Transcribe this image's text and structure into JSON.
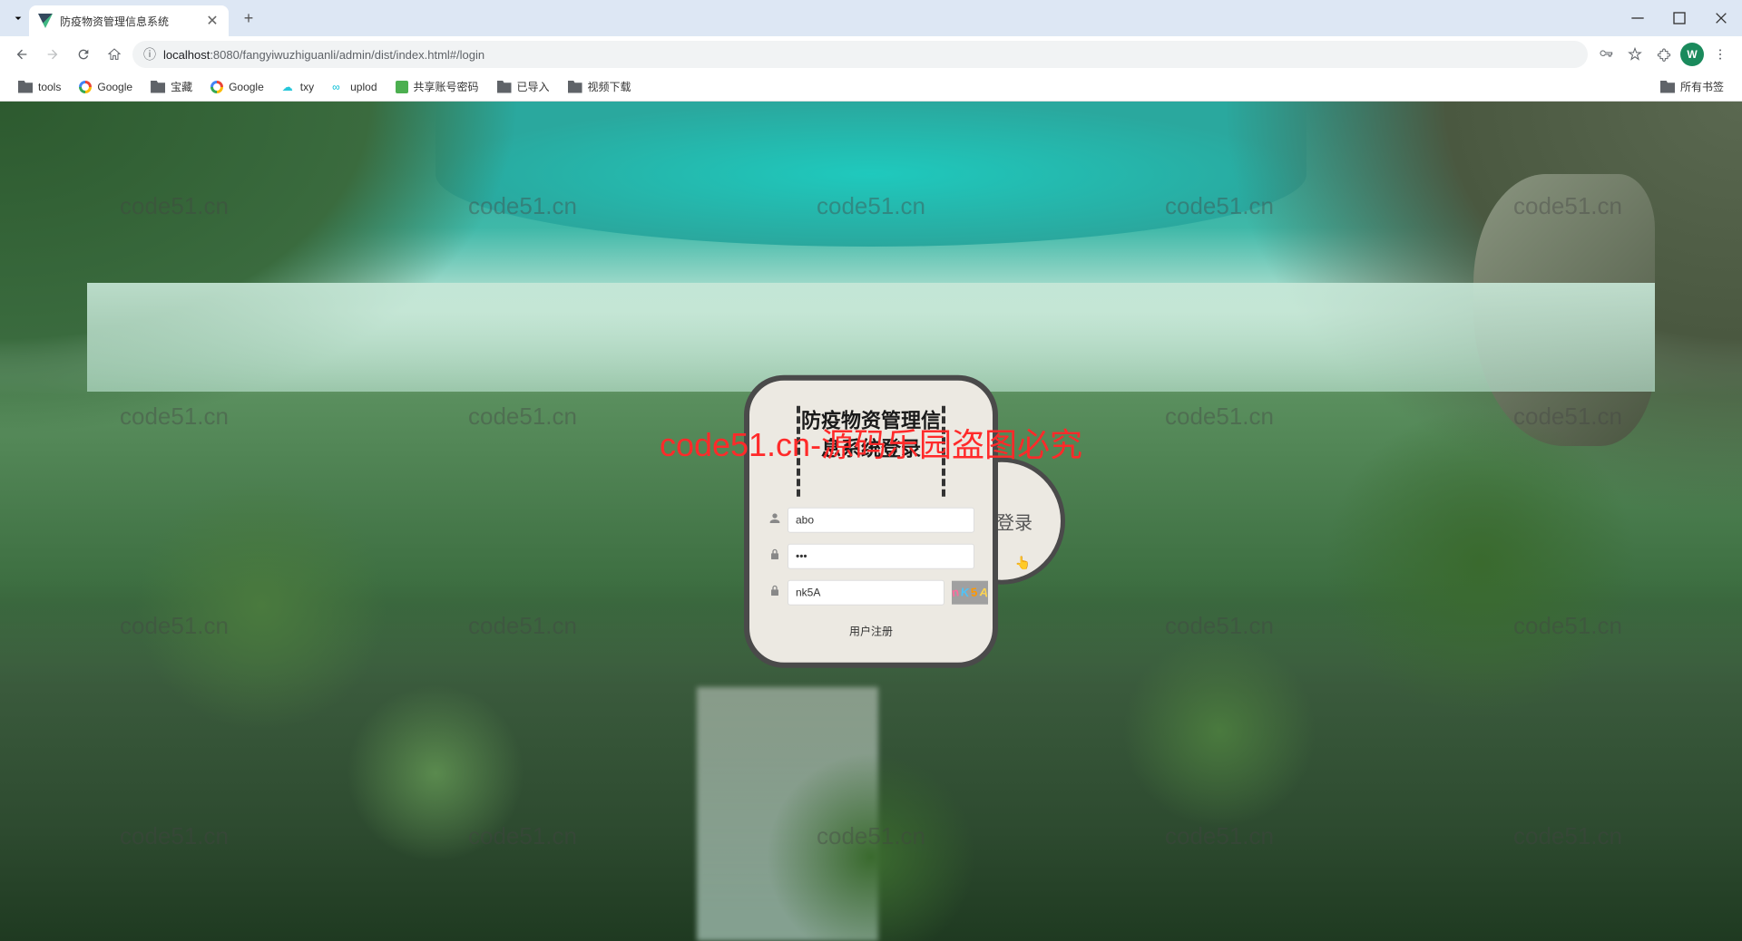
{
  "browser": {
    "tab_title": "防疫物资管理信息系统",
    "url_host": "localhost",
    "url_port_path": ":8080/fangyiwuzhiguanli/admin/dist/index.html#/login",
    "avatar_letter": "W"
  },
  "bookmarks": {
    "items": [
      {
        "label": "tools",
        "type": "folder"
      },
      {
        "label": "Google",
        "type": "google"
      },
      {
        "label": "宝藏",
        "type": "folder"
      },
      {
        "label": "Google",
        "type": "google"
      },
      {
        "label": "txy",
        "type": "cloud"
      },
      {
        "label": "uplod",
        "type": "link"
      },
      {
        "label": "共享账号密码",
        "type": "square"
      },
      {
        "label": "已导入",
        "type": "folder"
      },
      {
        "label": "视频下载",
        "type": "folder"
      }
    ],
    "all_bookmarks": "所有书签"
  },
  "watermark": {
    "text": "code51.cn",
    "red_text": "code51.cn-源码乐园盗图必究"
  },
  "login": {
    "title": "防疫物资管理信息系统登录",
    "username_value": "abo",
    "password_value": "•••",
    "captcha_value": "nk5A",
    "captcha_chars": [
      "n",
      "K",
      "5",
      "A"
    ],
    "login_btn": "登录",
    "register_link": "用户注册"
  }
}
